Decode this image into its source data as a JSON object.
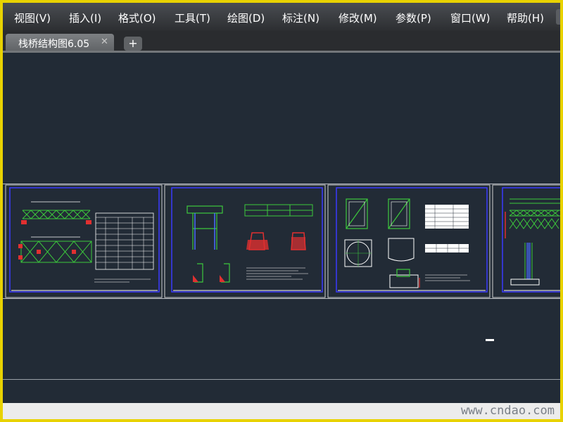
{
  "menubar": {
    "items": [
      {
        "label": "视图(V)"
      },
      {
        "label": "插入(I)"
      },
      {
        "label": "格式(O)"
      },
      {
        "label": "工具(T)"
      },
      {
        "label": "绘图(D)"
      },
      {
        "label": "标注(N)"
      },
      {
        "label": "修改(M)"
      },
      {
        "label": "参数(P)"
      },
      {
        "label": "窗口(W)"
      },
      {
        "label": "帮助(H)"
      }
    ]
  },
  "tabs": {
    "active_label": "栈桥结构图6.05",
    "close_glyph": "✕",
    "add_glyph": "+"
  },
  "watermark": {
    "bottom": "www.cndao.com"
  },
  "colors": {
    "frame": "#e8d200",
    "canvas_bg": "#222b36",
    "sheet_border": "#3a3aff",
    "drawing_green": "#3cc83c",
    "drawing_red": "#e03030",
    "paper": "#ffffff"
  }
}
